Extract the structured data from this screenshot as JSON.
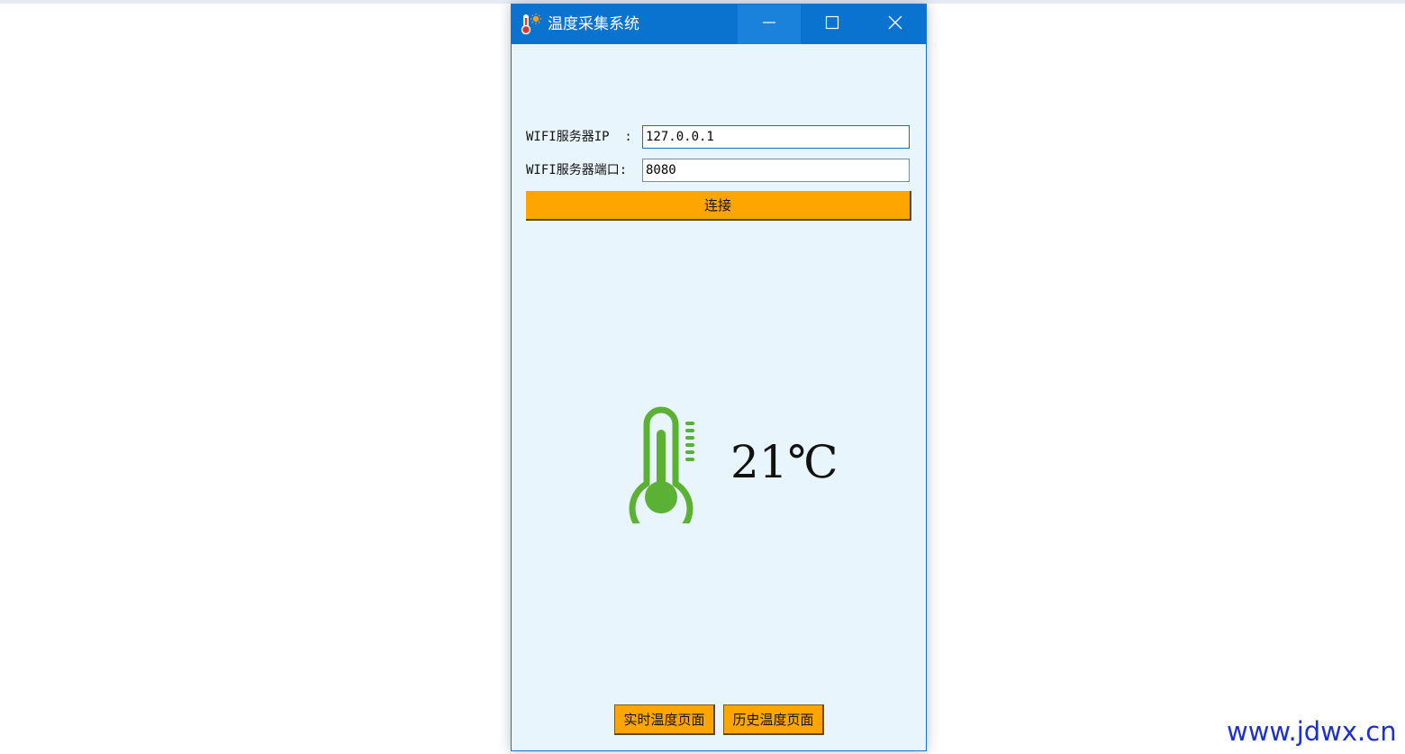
{
  "window": {
    "title": "温度采集系统",
    "icons": {
      "app": "thermometer-sun-icon",
      "minimize": "minimize-icon",
      "maximize": "maximize-icon",
      "close": "close-icon"
    },
    "titlebar_color": "#0a73d0",
    "background_color": "#e9f5fc"
  },
  "form": {
    "ip_label": "WIFI服务器IP  :",
    "ip_value": "127.0.0.1",
    "port_label": "WIFI服务器端口:",
    "port_value": "8080",
    "connect_label": "连接",
    "button_color": "#fea500"
  },
  "reading": {
    "icon": "thermometer-icon",
    "icon_color": "#5ab133",
    "temperature": "21℃"
  },
  "nav": {
    "realtime_label": "实时温度页面",
    "history_label": "历史温度页面"
  },
  "watermark": "www.jdwx.cn"
}
